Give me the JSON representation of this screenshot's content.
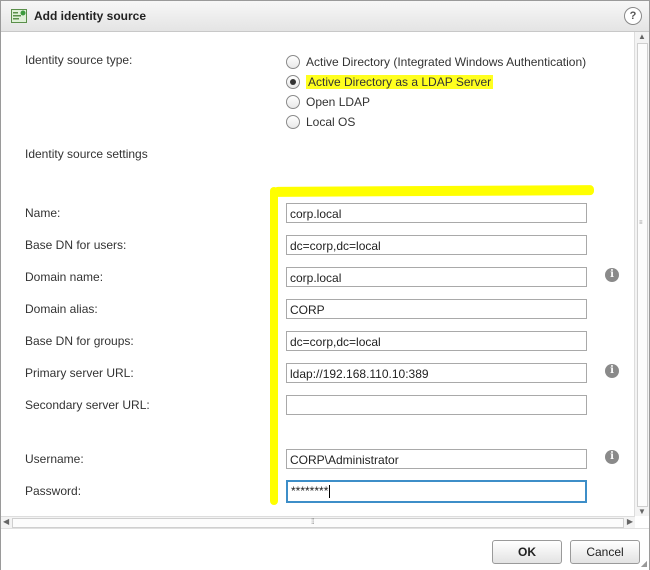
{
  "window": {
    "title": "Add identity source",
    "help_label": "?"
  },
  "source_type": {
    "label": "Identity source type:",
    "options": [
      {
        "label": "Active Directory (Integrated Windows Authentication)",
        "selected": false
      },
      {
        "label": "Active Directory as a LDAP Server",
        "selected": true
      },
      {
        "label": "Open LDAP",
        "selected": false
      },
      {
        "label": "Local OS",
        "selected": false
      }
    ]
  },
  "settings": {
    "header": "Identity source settings",
    "name": {
      "label": "Name:",
      "value": "corp.local"
    },
    "base_dn_users": {
      "label": "Base DN for users:",
      "value": "dc=corp,dc=local"
    },
    "domain_name": {
      "label": "Domain name:",
      "value": "corp.local"
    },
    "domain_alias": {
      "label": "Domain alias:",
      "value": "CORP"
    },
    "base_dn_groups": {
      "label": "Base DN for groups:",
      "value": "dc=corp,dc=local"
    },
    "primary_url": {
      "label": "Primary server URL:",
      "value": "ldap://192.168.110.10:389"
    },
    "secondary_url": {
      "label": "Secondary server URL:",
      "value": ""
    },
    "username": {
      "label": "Username:",
      "value": "CORP\\Administrator"
    },
    "password": {
      "label": "Password:",
      "value": "********"
    }
  },
  "info_icon_glyph": "i",
  "footer": {
    "ok_label": "OK",
    "cancel_label": "Cancel"
  },
  "colors": {
    "highlight": "#ffff1f",
    "focus_border": "#3d8ec8"
  }
}
